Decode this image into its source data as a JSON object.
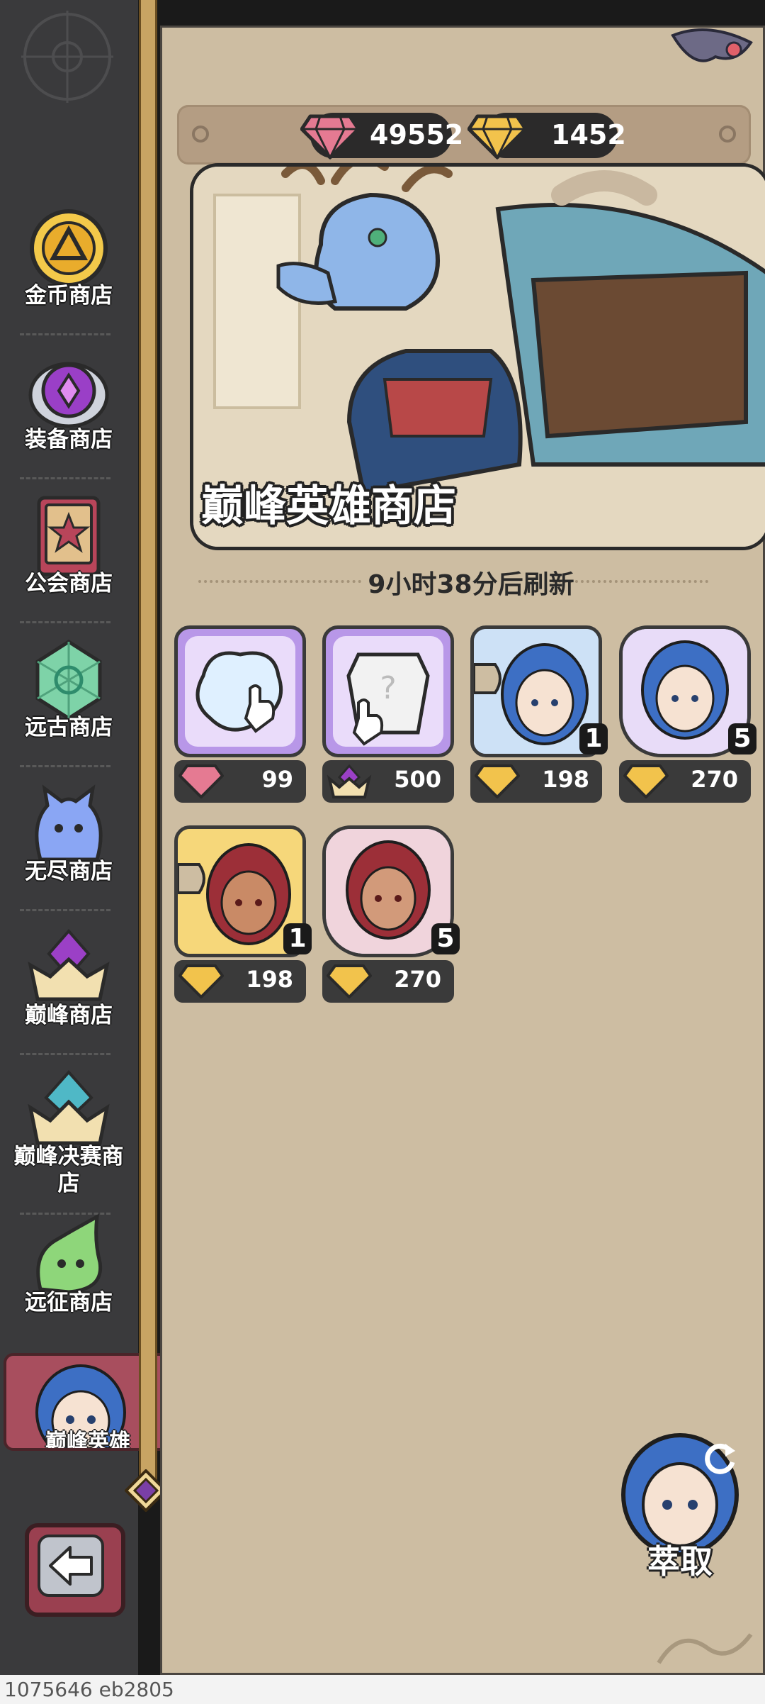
{
  "sidebar": {
    "items": [
      {
        "label": "金币商店",
        "icon": "gold-coin-icon"
      },
      {
        "label": "装备商店",
        "icon": "purple-gem-icon"
      },
      {
        "label": "公会商店",
        "icon": "guild-banner-icon"
      },
      {
        "label": "远古商店",
        "icon": "ancient-crystal-icon"
      },
      {
        "label": "无尽商店",
        "icon": "slime-icon"
      },
      {
        "label": "巅峰商店",
        "icon": "crown-icon"
      },
      {
        "label": "巅峰决赛商店",
        "icon": "finals-crown-icon"
      },
      {
        "label": "远征商店",
        "icon": "green-slime-icon"
      }
    ],
    "active_tab_label": "巅峰英雄"
  },
  "currency": {
    "ruby": "49552",
    "gold": "1452"
  },
  "banner": {
    "title": "巅峰英雄商店"
  },
  "refresh_text": "9小时38分后刷新",
  "items": [
    {
      "price": "99",
      "currency": "ruby"
    },
    {
      "price": "500",
      "currency": "crown"
    },
    {
      "price": "198",
      "currency": "gold",
      "count": "1"
    },
    {
      "price": "270",
      "currency": "gold",
      "count": "5"
    },
    {
      "price": "198",
      "currency": "gold",
      "count": "1"
    },
    {
      "price": "270",
      "currency": "gold",
      "count": "5"
    }
  ],
  "extract_label": "萃取",
  "footer": "1075646 eb2805",
  "colors": {
    "panel": "#cdbda2",
    "sidebar": "#3a3a3c",
    "ruby": "#e0607a",
    "gold": "#f0c040"
  }
}
